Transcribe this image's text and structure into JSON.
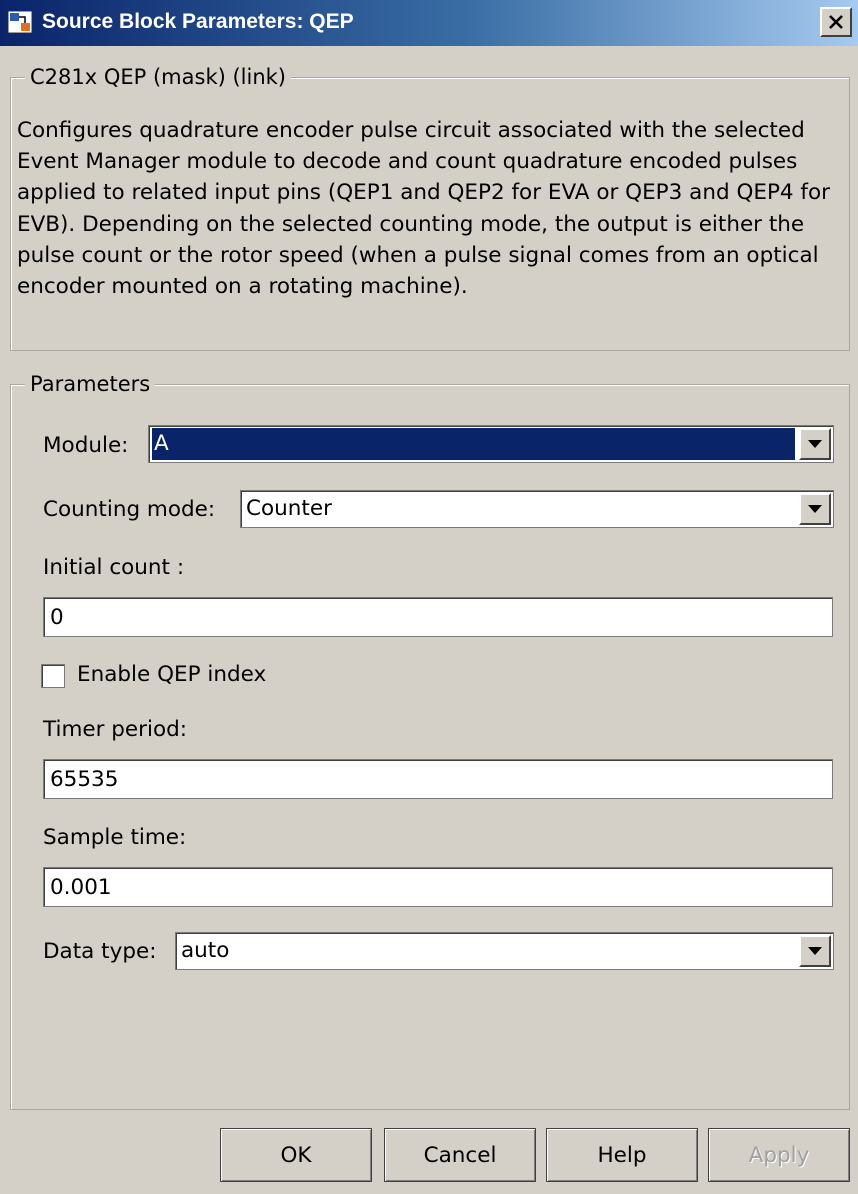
{
  "window": {
    "title": "Source Block Parameters: QEP"
  },
  "description": {
    "group_title": "C281x QEP (mask) (link)",
    "text": "Configures quadrature encoder pulse circuit associated with the selected Event Manager module to decode and count quadrature encoded pulses applied to related input pins (QEP1 and QEP2 for EVA or QEP3 and QEP4 for EVB). Depending on the selected counting mode, the output is either the pulse count or the rotor speed (when a pulse signal comes from an optical encoder mounted on a rotating machine)."
  },
  "parameters": {
    "group_title": "Parameters",
    "module": {
      "label": "Module:",
      "value": "A"
    },
    "counting_mode": {
      "label": "Counting mode:",
      "value": "Counter"
    },
    "initial_count": {
      "label": "Initial count :",
      "value": "0"
    },
    "enable_qep_index": {
      "label": "Enable QEP index",
      "checked": false
    },
    "timer_period": {
      "label": "Timer period:",
      "value": "65535"
    },
    "sample_time": {
      "label": "Sample time:",
      "value": "0.001"
    },
    "data_type": {
      "label": "Data type:",
      "value": "auto"
    }
  },
  "buttons": {
    "ok": "OK",
    "cancel": "Cancel",
    "help": "Help",
    "apply": "Apply"
  },
  "icons": {
    "app": "simulink-block-icon",
    "close": "close-icon",
    "dropdown": "chevron-down-icon"
  },
  "colors": {
    "title_bar_start": "#0a246a",
    "selection": "#0a246a",
    "dialog_bg": "#d4d0c8"
  }
}
